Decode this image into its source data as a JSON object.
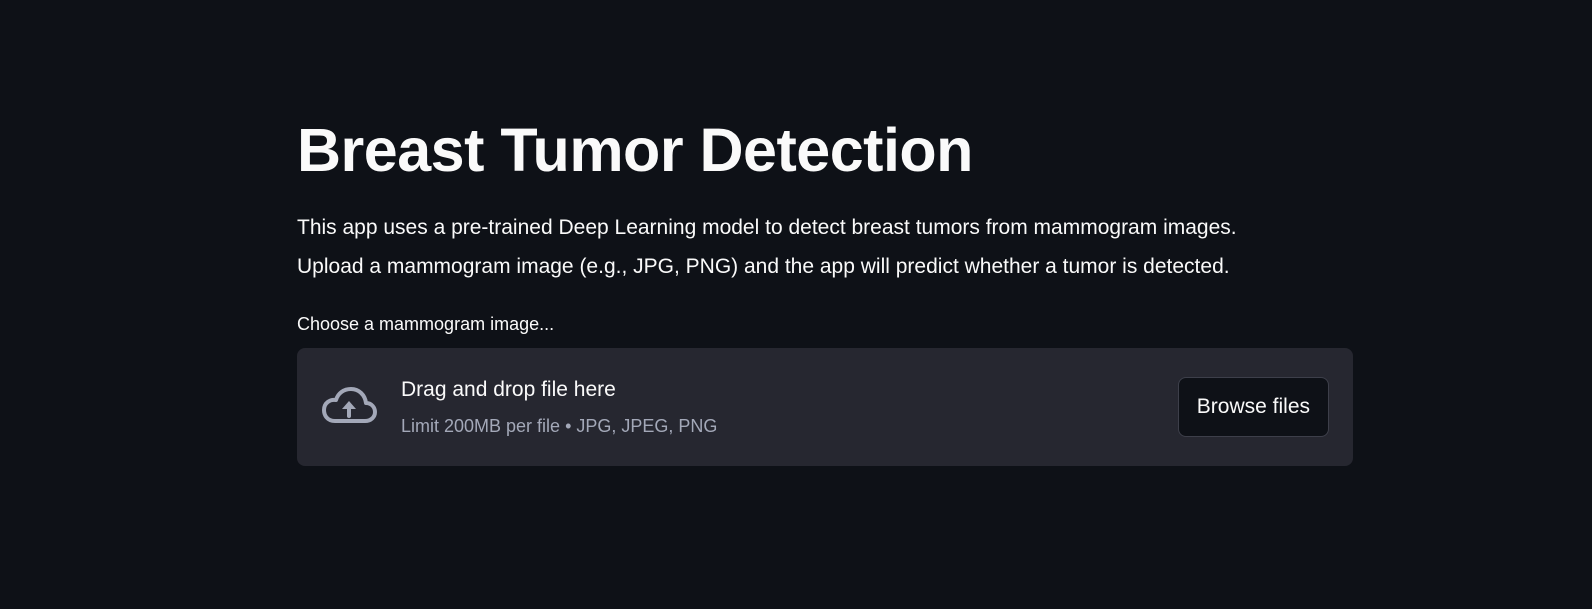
{
  "page": {
    "title": "Breast Tumor Detection",
    "description_lines": [
      "This app uses a pre-trained Deep Learning model to detect breast tumors from mammogram images.",
      "Upload a mammogram image (e.g., JPG, PNG) and the app will predict whether a tumor is detected."
    ]
  },
  "uploader": {
    "label": "Choose a mammogram image...",
    "drop_title": "Drag and drop file here",
    "drop_subtitle": "Limit 200MB per file • JPG, JPEG, PNG",
    "browse_label": "Browse files",
    "icon": "cloud-upload-icon"
  },
  "colors": {
    "background": "#0e1117",
    "dropzone": "#262730",
    "text": "#fafafa",
    "muted_text": "#a3a8b8"
  }
}
